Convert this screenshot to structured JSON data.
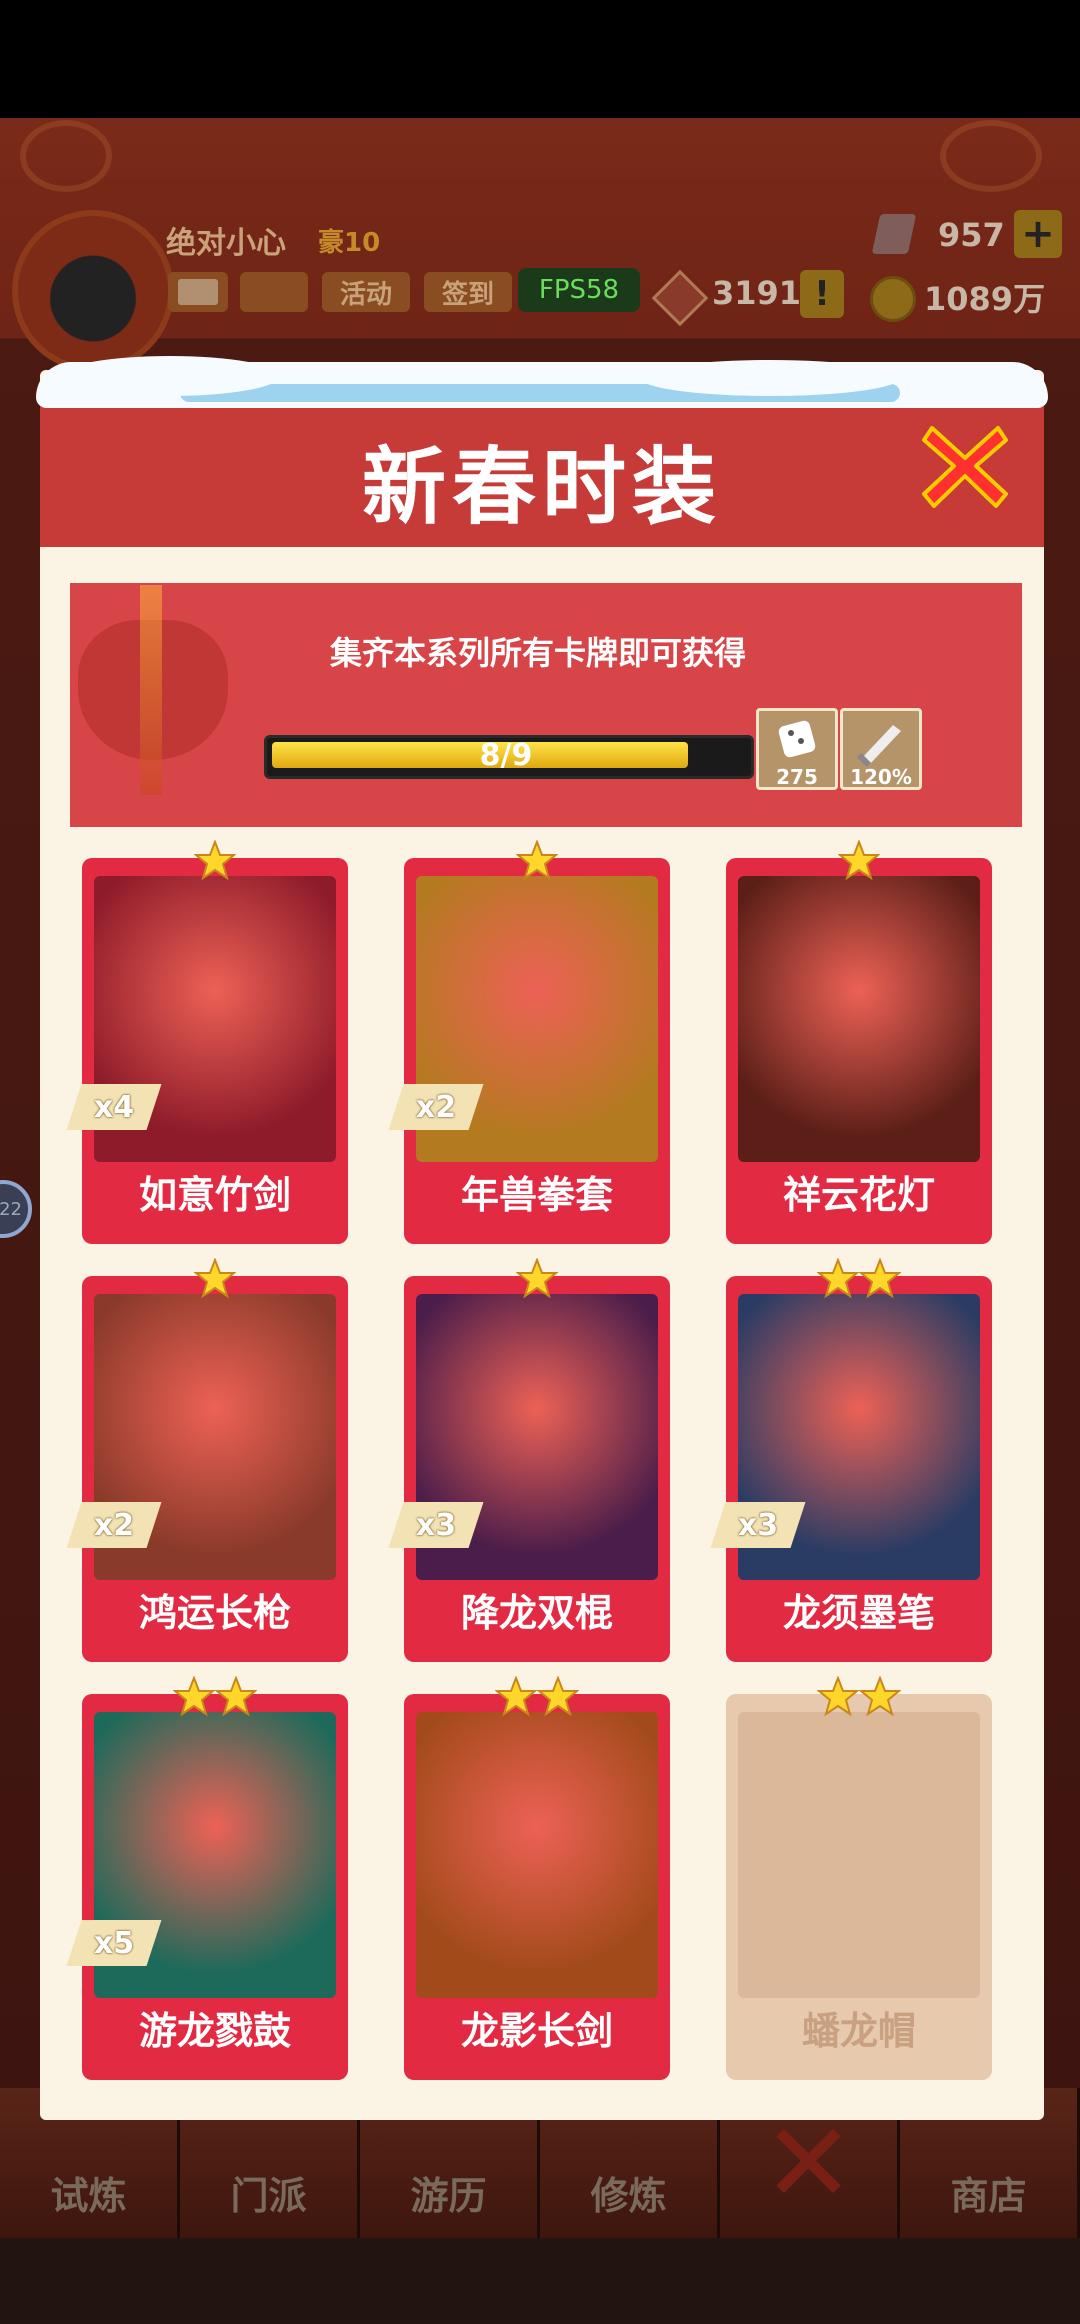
{
  "hud": {
    "player_name": "绝对小心",
    "vip_level": "豪10",
    "buttons": [
      "",
      "",
      "活动",
      "签到"
    ],
    "fps": "FPS58",
    "gems": "957",
    "tokens": "3191",
    "coins": "1089万"
  },
  "modal": {
    "title": "新春时装",
    "banner": {
      "text": "集齐本系列所有卡牌即可获得",
      "progress_text": "8/9",
      "progress_fraction": 0.889,
      "rewards": [
        {
          "icon": "dice-icon",
          "value": "275"
        },
        {
          "icon": "sword-icon",
          "value": "120%"
        }
      ]
    },
    "cards": [
      {
        "name": "如意竹剑",
        "stars": 1,
        "count": "x4",
        "locked": false,
        "bg": "#8e1b2a"
      },
      {
        "name": "年兽拳套",
        "stars": 1,
        "count": "x2",
        "locked": false,
        "bg": "#b47a20"
      },
      {
        "name": "祥云花灯",
        "stars": 1,
        "count": "",
        "locked": false,
        "bg": "#5c1f18"
      },
      {
        "name": "鸿运长枪",
        "stars": 1,
        "count": "x2",
        "locked": false,
        "bg": "#8a3a2a"
      },
      {
        "name": "降龙双棍",
        "stars": 1,
        "count": "x3",
        "locked": false,
        "bg": "#4b1d4a"
      },
      {
        "name": "龙须墨笔",
        "stars": 2,
        "count": "x3",
        "locked": false,
        "bg": "#2b3c64"
      },
      {
        "name": "游龙戮鼓",
        "stars": 2,
        "count": "x5",
        "locked": false,
        "bg": "#1e6a5a"
      },
      {
        "name": "龙影长剑",
        "stars": 2,
        "count": "",
        "locked": false,
        "bg": "#a24a1a"
      },
      {
        "name": "蟠龙帽",
        "stars": 2,
        "count": "",
        "locked": true,
        "bg": "#dcb89a"
      }
    ]
  },
  "bottom_nav": [
    "试炼",
    "门派",
    "游历",
    "修炼",
    "",
    "商店"
  ]
}
